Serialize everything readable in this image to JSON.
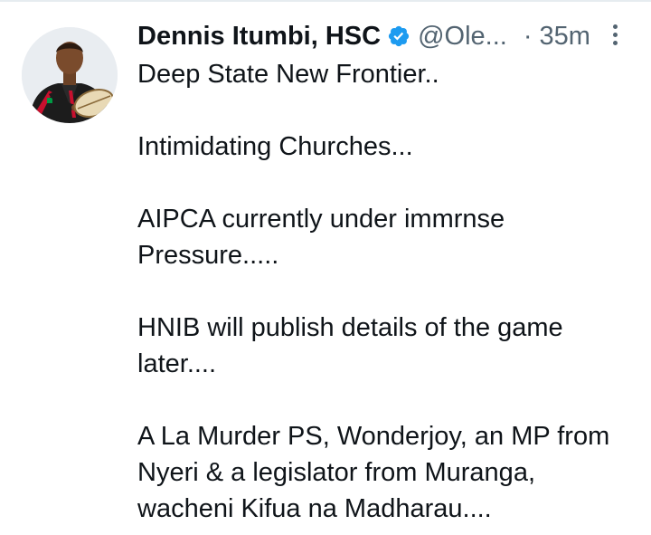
{
  "tweet": {
    "author_name": "Dennis Itumbi, HSC",
    "handle": "@Ole...",
    "separator": "·",
    "time": "35m",
    "verified": true,
    "text": "Deep State New Frontier..\n\nIntimidating Churches...\n\nAIPCA currently under immrnse\nPressure.....\n\nHNIB will publish details of the game\nlater....\n\nA La Murder PS, Wonderjoy, an MP from\nNyeri & a legislator from Muranga,\nwacheni Kifua na Madharau...."
  },
  "icons": {
    "verified": "verified-badge-icon",
    "more": "more-vertical-icon"
  },
  "colors": {
    "text": "#0f1419",
    "secondary": "#536471",
    "verified": "#1d9bf0",
    "background": "#ffffff"
  }
}
